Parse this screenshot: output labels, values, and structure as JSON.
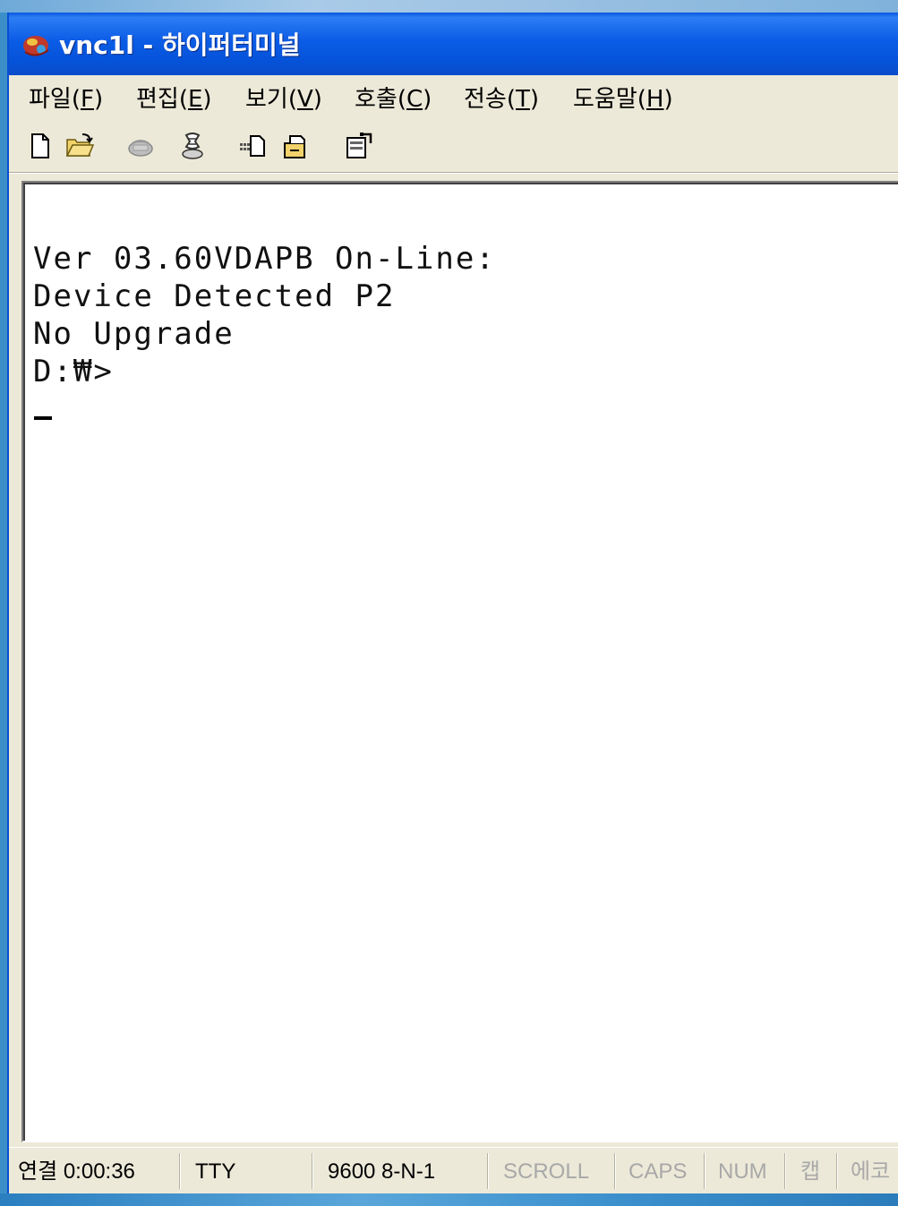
{
  "window": {
    "title": "vnc1l - 하이퍼터미널"
  },
  "menu": {
    "file": {
      "label": "파일(",
      "key": "F",
      "close": ")"
    },
    "edit": {
      "label": "편집(",
      "key": "E",
      "close": ")"
    },
    "view": {
      "label": "보기(",
      "key": "V",
      "close": ")"
    },
    "call": {
      "label": "호출(",
      "key": "C",
      "close": ")"
    },
    "transfer": {
      "label": "전송(",
      "key": "T",
      "close": ")"
    },
    "help": {
      "label": "도움말(",
      "key": "H",
      "close": ")"
    }
  },
  "toolbar": {
    "icons": [
      "new-document-icon",
      "open-folder-icon",
      "connect-icon",
      "disconnect-icon",
      "send-icon",
      "receive-icon",
      "properties-icon"
    ]
  },
  "terminal": {
    "lines": [
      "Ver 03.60VDAPB On-Line:",
      "Device Detected P2",
      "No Upgrade",
      "D:₩>"
    ]
  },
  "status": {
    "connection": "연결 0:00:36",
    "emulation": "TTY",
    "settings": "9600 8-N-1",
    "scroll": "SCROLL",
    "caps": "CAPS",
    "num": "NUM",
    "capture": "캡",
    "echo": "에코"
  },
  "colors": {
    "titlebar": "#0a58e0",
    "chrome": "#ece9d8",
    "terminal_bg": "#ffffff",
    "terminal_text": "#111111",
    "status_dim": "#a8a8a8"
  }
}
